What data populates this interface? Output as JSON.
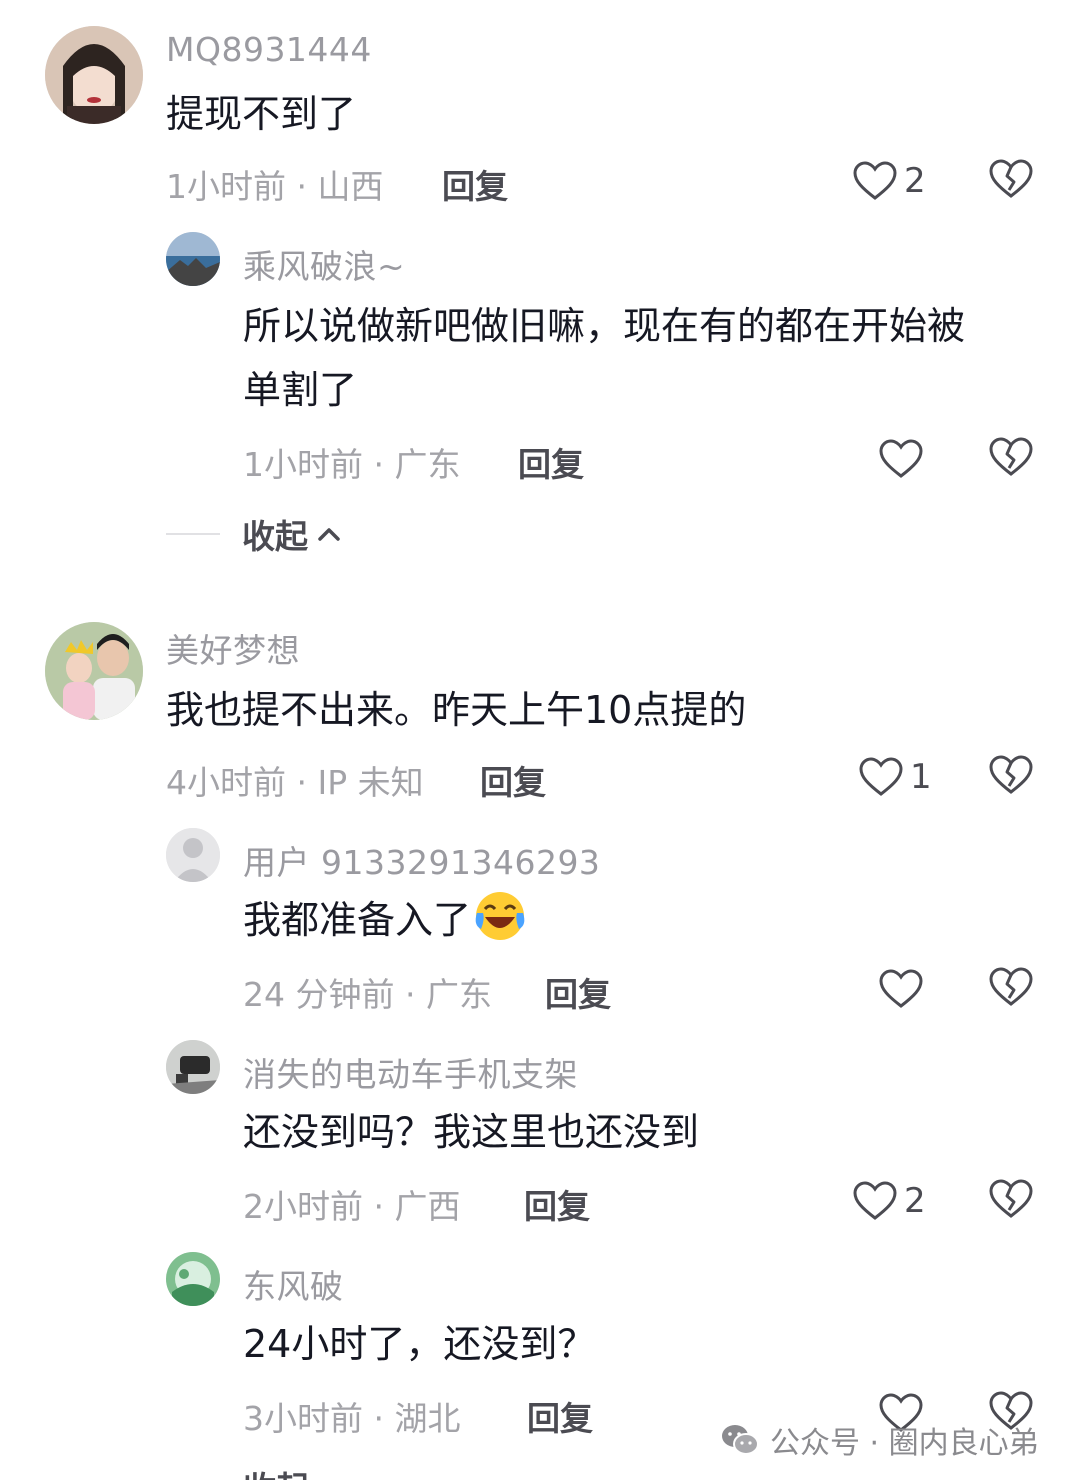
{
  "comments": [
    {
      "username": "MQ8931444",
      "text": "提现不到了",
      "meta": "1小时前 · 山西",
      "reply": "回复",
      "likes": "2",
      "replies": [
        {
          "username": "乘风破浪~",
          "text_line1": "所以说做新吧做旧嘛，现在有的都在开始被",
          "text_line2": "单割了",
          "meta": "1小时前 · 广东",
          "reply": "回复"
        }
      ],
      "collapse": "收起"
    },
    {
      "username": "美好梦想",
      "text": "我也提不出来。昨天上午10点提的",
      "meta": "4小时前 · IP 未知",
      "reply": "回复",
      "likes": "1",
      "replies": [
        {
          "username": "用户 9133291346293",
          "text": "我都准备入了",
          "meta": "24 分钟前 · 广东",
          "reply": "回复"
        },
        {
          "username": "消失的电动车手机支架",
          "text": "还没到吗？我这里也还没到",
          "meta": "2小时前 · 广西",
          "reply": "回复",
          "likes": "2"
        },
        {
          "username": "东风破",
          "text": "24小时了，还没到？",
          "meta": "3小时前 · 湖北",
          "reply": "回复"
        }
      ],
      "collapse": "收起"
    }
  ],
  "watermark": {
    "label": "公众号 · 圈内良心弟"
  },
  "icons": {
    "like": "heart-outline-icon",
    "dislike": "broken-heart-icon",
    "emoji": "laughing-crying-emoji-icon",
    "collapse": "chevron-up-icon",
    "watermark": "wechat-icon"
  },
  "colors": {
    "text": "#161823",
    "username": "#9a9aa0",
    "meta": "#a3a3a8",
    "reply": "#4b4b52"
  }
}
